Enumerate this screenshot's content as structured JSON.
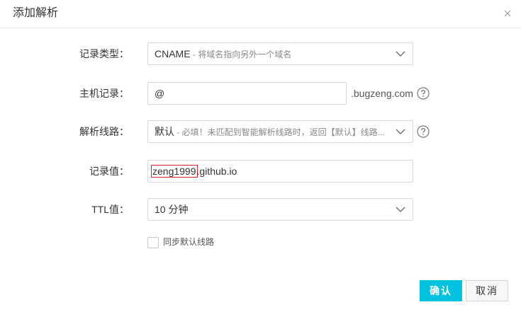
{
  "dialog": {
    "title": "添加解析",
    "close_icon": "close-icon"
  },
  "form": {
    "record_type": {
      "label": "记录类型：",
      "value": "CNAME",
      "hint": " - 将域名指向另外一个域名"
    },
    "host": {
      "label": "主机记录：",
      "value": "@",
      "suffix": ".bugzeng.com"
    },
    "line": {
      "label": "解析线路：",
      "value": "默认",
      "hint": " - 必填！未匹配到智能解析线路时，返回【默认】线路..."
    },
    "record_value": {
      "label": "记录值：",
      "value_highlight": "zeng1999",
      "value_rest": ".github.io"
    },
    "ttl": {
      "label": "TTL值：",
      "value": "10 分钟"
    },
    "sync_default": {
      "label": "同步默认线路",
      "checked": false
    }
  },
  "buttons": {
    "ok_label": "确认",
    "cancel_label": "取消"
  },
  "colors": {
    "primary": "#00c1de",
    "highlight_border": "#d9232b"
  }
}
